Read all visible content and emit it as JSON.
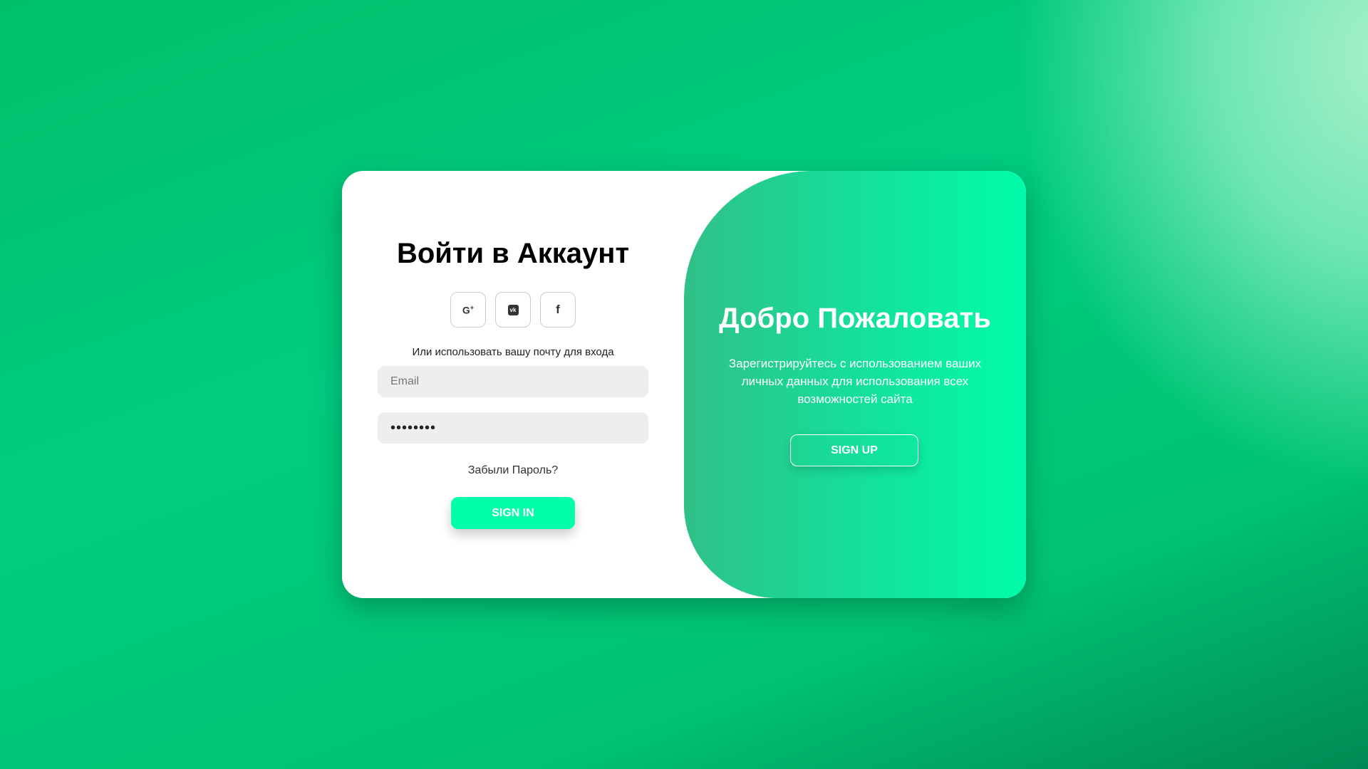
{
  "signin": {
    "title": "Войти в Аккаунт",
    "socials": [
      {
        "icon": "google-plus-icon",
        "label": "G+"
      },
      {
        "icon": "vk-icon",
        "label": "VK"
      },
      {
        "icon": "facebook-icon",
        "label": "f"
      }
    ],
    "hint": "Или использовать вашу почту для входа",
    "email_placeholder": "Email",
    "email_value": "",
    "password_value": "••••••••",
    "forgot": "Забыли Пароль?",
    "button": "SIGN IN"
  },
  "welcome": {
    "title": "Добро Пожаловать",
    "text": "Зарегистрируйтесь с использованием ваших личных данных для использования всех возможностей сайта",
    "button": "SIGN UP"
  },
  "colors": {
    "accent": "#00ffaa",
    "panel_start": "#30c088",
    "panel_end": "#00fcaa"
  }
}
